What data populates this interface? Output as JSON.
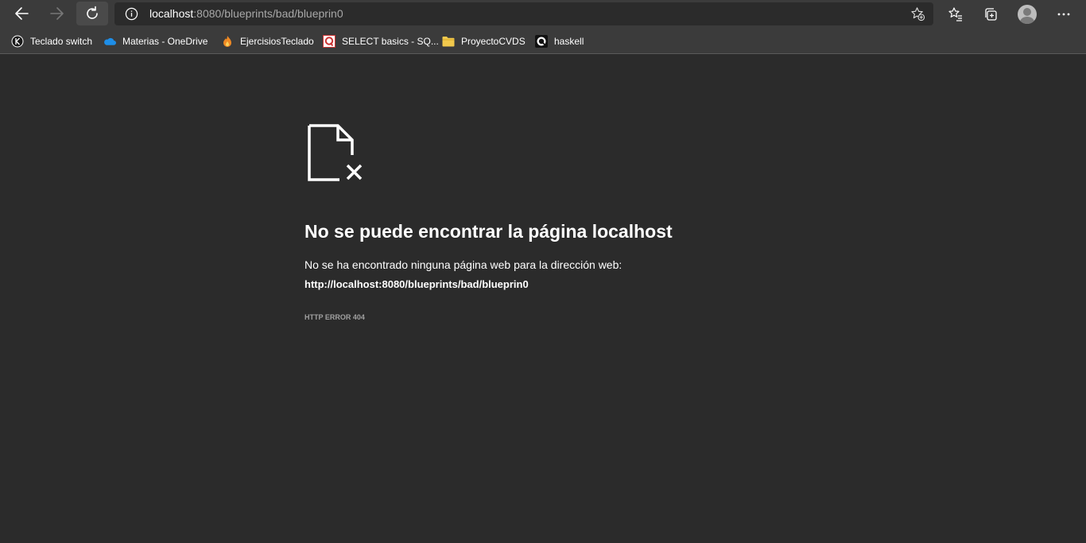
{
  "toolbar": {
    "back_icon": "arrow-left-icon",
    "forward_icon": "arrow-right-icon",
    "reload_icon": "refresh-icon",
    "info_icon": "info-icon",
    "favorite_add_icon": "star-add-icon",
    "favorites_icon": "favorites-list-icon",
    "collections_icon": "collections-icon",
    "profile_icon": "profile-avatar-icon",
    "more_icon": "ellipsis-icon"
  },
  "address_bar": {
    "host": "localhost",
    "rest": ":8080/blueprints/bad/blueprin0"
  },
  "bookmarks": [
    {
      "label": "Teclado switch",
      "icon": "k-logo-icon"
    },
    {
      "label": "Materias - OneDrive",
      "icon": "onedrive-cloud-icon"
    },
    {
      "label": "EjercisiosTeclado",
      "icon": "fire-icon"
    },
    {
      "label": "SELECT basics - SQ...",
      "icon": "sqlzoo-icon"
    },
    {
      "label": "ProyectoCVDS",
      "icon": "folder-icon"
    },
    {
      "label": "haskell",
      "icon": "haskell-icon"
    }
  ],
  "error": {
    "icon": "broken-page-icon",
    "title": "No se puede encontrar la página localhost",
    "description": "No se ha encontrado ninguna página web para la dirección web:",
    "url": "http://localhost:8080/blueprints/bad/blueprin0",
    "code": "HTTP ERROR 404"
  },
  "colors": {
    "page_background": "#2b2b2b",
    "toolbar_background": "#3b3b3b",
    "text": "#ffffff",
    "muted_text": "#a8a8a8"
  }
}
